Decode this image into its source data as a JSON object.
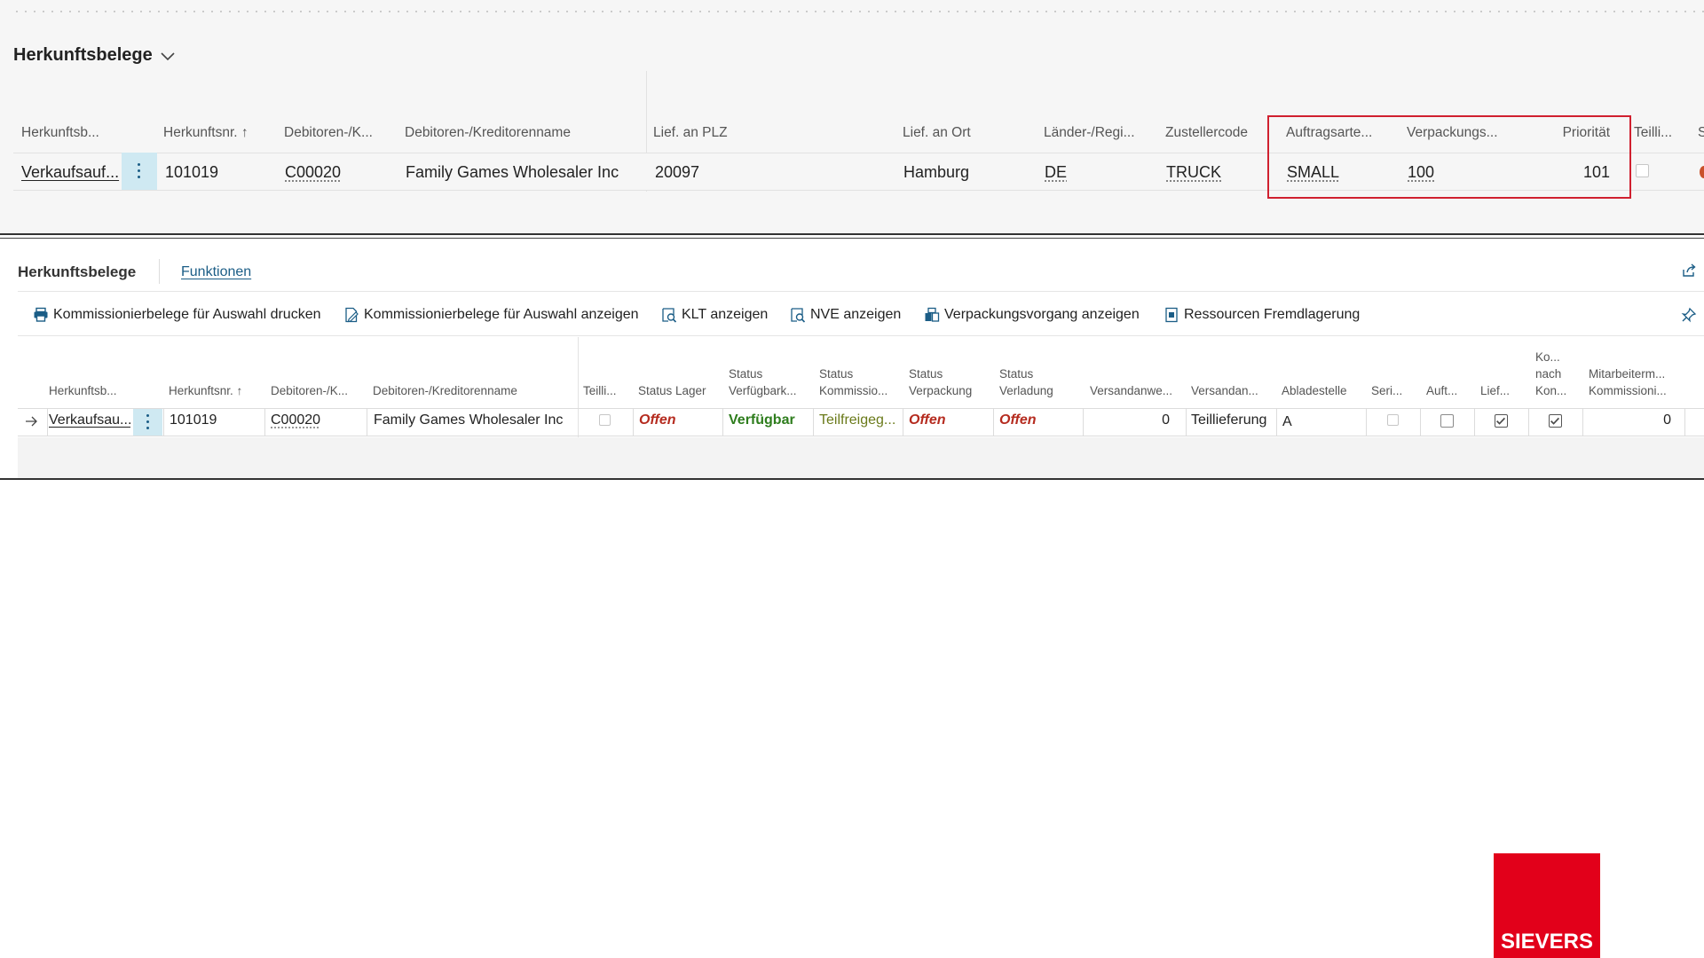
{
  "top_section": {
    "title": "Herkunftsbelege",
    "columns": {
      "c1": "Herkunftsb...",
      "c2": "Herkunftsnr. ↑",
      "c3": "Debitoren-/K...",
      "c4": "Debitoren-/Kreditorenname",
      "c5": "Lief. an PLZ",
      "c6": "Lief. an Ort",
      "c7": "Länder-/Regi...",
      "c8": "Zustellercode",
      "c9": "Auftragsarte...",
      "c10": "Verpackungs...",
      "c11": "Priorität",
      "c12": "Teilli...",
      "c13": "S"
    },
    "row": {
      "c1": "Verkaufsauf...",
      "c2": "101019",
      "c3": "C00020",
      "c4": "Family Games Wholesaler Inc",
      "c5": "20097",
      "c6": "Hamburg",
      "c7": "DE",
      "c8": "TRUCK",
      "c9": "SMALL",
      "c10": "100",
      "c11": "101"
    }
  },
  "bottom_section": {
    "title": "Herkunftsbelege",
    "tab": "Funktionen",
    "actions": {
      "a1": "Kommissionierbelege für Auswahl drucken",
      "a2": "Kommissionierbelege für Auswahl anzeigen",
      "a3": "KLT anzeigen",
      "a4": "NVE anzeigen",
      "a5": "Verpackungsvorgang anzeigen",
      "a6": "Ressourcen Fremdlagerung"
    },
    "columns": {
      "c1": "Herkunftsb...",
      "c2": "Herkunftsnr. ↑",
      "c3": "Debitoren-/K...",
      "c4": "Debitoren-/Kreditorenname",
      "c5": "Teilli...",
      "c6": "Status Lager",
      "c7a": "Status",
      "c7b": "Verfügbark...",
      "c8a": "Status",
      "c8b": "Kommissio...",
      "c9a": "Status",
      "c9b": "Verpackung",
      "c10a": "Status",
      "c10b": "Verladung",
      "c11": "Versandanwe...",
      "c12": "Versandan...",
      "c13": "Abladestelle",
      "c14": "Seri...",
      "c15": "Auft...",
      "c16": "Lief...",
      "c17a": "Ko...",
      "c17b": "nach",
      "c17c": "Kon...",
      "c18a": "Mitarbeiterm...",
      "c18b": "Kommissioni..."
    },
    "row": {
      "c1": "Verkaufsau...",
      "c2": "101019",
      "c3": "C00020",
      "c4": "Family Games Wholesaler Inc",
      "c6": "Offen",
      "c7": "Verfügbar",
      "c8": "Teilfreigeg...",
      "c9": "Offen",
      "c10": "Offen",
      "c11": "0",
      "c12": "Teillieferung",
      "c13": "A",
      "c18": "0"
    }
  },
  "logo": {
    "text": "SIEVERS"
  },
  "colors": {
    "highlight": "#d0202f",
    "accent_link": "#1b5d86",
    "status_red": "#b52b1f",
    "status_green": "#2e7d1d",
    "logo_red": "#e2001a"
  }
}
